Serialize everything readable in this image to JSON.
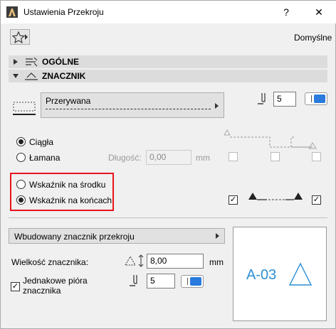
{
  "window": {
    "title": "Ustawienia Przekroju",
    "help_label": "?",
    "close_label": "✕"
  },
  "toolbar": {
    "defaults_label": "Domyślne"
  },
  "sections": {
    "general": "OGÓLNE",
    "marker": "ZNACZNIK"
  },
  "line_type": {
    "label": "Przerywana"
  },
  "pen": {
    "value": "5"
  },
  "line_style": {
    "solid_label": "Ciągła",
    "broken_label": "Łamana",
    "selected": "Ciągła",
    "length_label": "Długość:",
    "length_value": "0,00",
    "length_unit": "mm"
  },
  "pointer": {
    "middle_label": "Wskaźnik na środku",
    "ends_label": "Wskaźnik na końcach",
    "selected": "Wskaźnik na końcach"
  },
  "marker": {
    "type_label": "Wbudowany znacznik przekroju",
    "size_label": "Wielkość znacznika:",
    "size_value": "8,00",
    "size_unit": "mm",
    "same_pens_label_1": "Jednakowe pióra",
    "same_pens_label_2": "znacznika",
    "same_pens_checked": true,
    "pen_value": "5",
    "preview_text": "A-03"
  },
  "colors": {
    "accent": "#2a7bde",
    "highlight": "#e8141c",
    "preview_text": "#2b8fd6"
  }
}
